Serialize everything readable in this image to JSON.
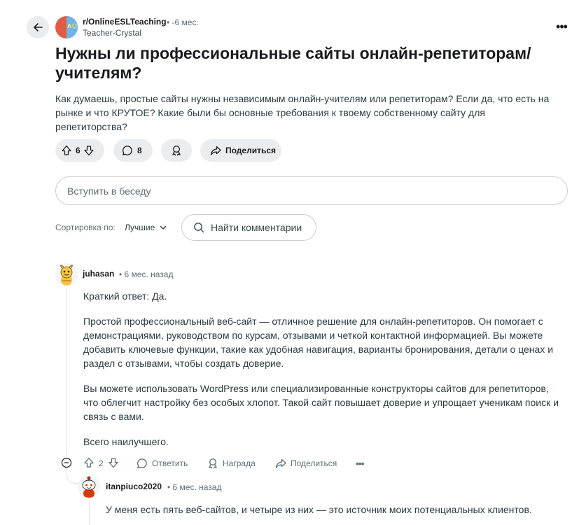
{
  "post": {
    "subreddit": "r/OnlineESLTeaching",
    "time": "• -6 мес.",
    "author": "Teacher-Crystal",
    "avatar_text": "A☺",
    "title": "Нужны ли профессиональные сайты онлайн-репетиторам/учителям?",
    "body": "Как думаешь, простые сайты нужны независимым онлайн-учителям или репетиторам? Если да, что есть на рынке и что КРУТОЕ? Какие были бы основные требования к твоему собственному сайту для репетиторства?",
    "votes": "6",
    "comments": "8",
    "share_label": "Поделиться"
  },
  "join": {
    "placeholder": "Вступить в беседу"
  },
  "sort": {
    "label": "Сортировка по:",
    "value": "Лучшие"
  },
  "search": {
    "placeholder": "Найти комментарии"
  },
  "comments": [
    {
      "author": "juhasan",
      "time": "• 6 мес. назад",
      "paragraphs": [
        "Краткий ответ: Да.",
        "Простой профессиональный веб-сайт — отличное решение для онлайн-репетиторов. Он помогает с демонстрациями, руководством по курсам, отзывами и четкой контактной информацией. Вы можете добавить ключевые функции, такие как удобная навигация, варианты бронирования, детали о ценах и раздел с отзывами, чтобы создать доверие.",
        "Вы можете использовать WordPress или специализированные конструкторы сайтов для репетиторов, что облегчит настройку без особых хлопот. Такой сайт повышает доверие и упрощает ученикам поиск и связь с вами.",
        "Всего наилучшего."
      ],
      "votes": "2",
      "reply_label": "Ответить",
      "award_label": "Награда",
      "share_label": "Поделиться"
    },
    {
      "author": "itanpiuco2020",
      "time": "• 6 мес. назад",
      "body": "У меня есть пять веб-сайтов, и четыре из них — это источник моих потенциальных клиентов."
    }
  ],
  "colors": {
    "pill_bg": "#eaedef",
    "text_primary": "#1c1c1c",
    "text_secondary": "#576f76",
    "avatar_red": "#e25b45",
    "avatar_blue": "#6fb4e8"
  },
  "icons": [
    "back-arrow-icon",
    "more-icon",
    "upvote-icon",
    "downvote-icon",
    "comment-icon",
    "award-icon",
    "share-icon",
    "chevron-down-icon",
    "search-icon",
    "collapse-icon",
    "snoo-avatar-icon"
  ]
}
